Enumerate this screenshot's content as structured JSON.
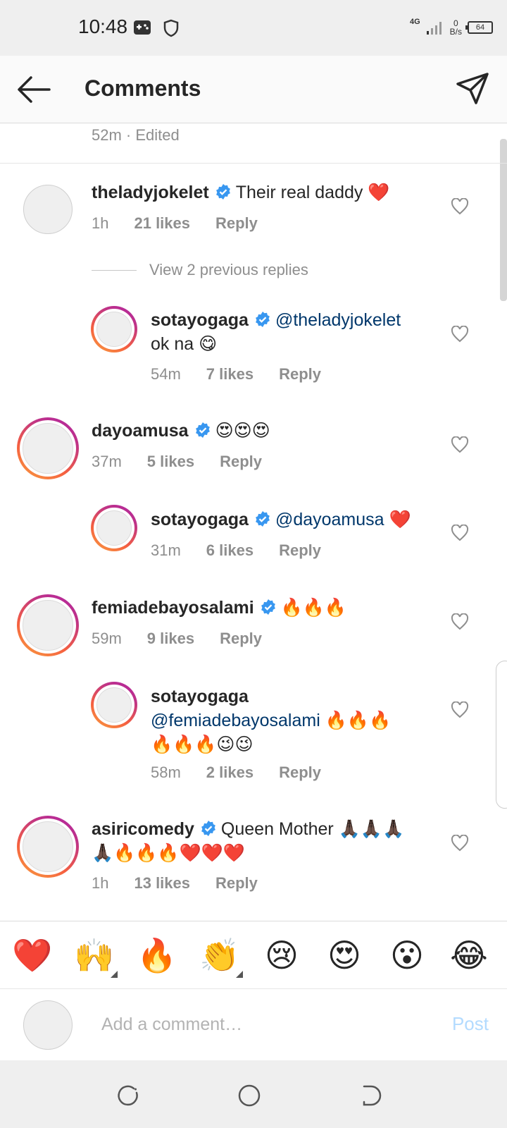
{
  "status_bar": {
    "time": "10:48",
    "network": "4G",
    "speed_value": "0",
    "speed_unit": "B/s",
    "battery": "64",
    "icons": [
      "game-icon",
      "shield-icon",
      "signal-icon",
      "battery-icon"
    ]
  },
  "header": {
    "title": "Comments",
    "back_icon": "arrow-left-icon",
    "share_icon": "send-icon"
  },
  "top_comment": {
    "meta": "52m · Edited"
  },
  "comments": [
    {
      "user": "theladyjokelet",
      "text": "Their real daddy ❤️",
      "time": "1h",
      "likes": "21 likes",
      "reply": "Reply",
      "verified": true
    },
    {
      "user": "sotayogaga",
      "mention": "@theladyjokelet",
      "text2": "ok na 😋",
      "time": "54m",
      "likes": "7 likes",
      "reply": "Reply",
      "verified": true
    },
    {
      "user": "dayoamusa",
      "text": "😍😍😍",
      "time": "37m",
      "likes": "5 likes",
      "reply": "Reply",
      "verified": true
    },
    {
      "user": "sotayogaga",
      "mention": "@dayoamusa",
      "text": "❤️",
      "time": "31m",
      "likes": "6 likes",
      "reply": "Reply",
      "verified": true
    },
    {
      "user": "femiadebayosalami",
      "text": "🔥🔥🔥",
      "time": "59m",
      "likes": "9 likes",
      "reply": "Reply",
      "verified": true
    },
    {
      "user": "sotayogaga",
      "mention": "@femiadebayosalami",
      "text": "🔥🔥🔥",
      "text2": "🔥🔥🔥😉😉",
      "time": "58m",
      "likes": "2 likes",
      "reply": "Reply",
      "verified": false
    },
    {
      "user": "asiricomedy",
      "text": "Queen Mother 🙏🏿🙏🏿🙏🏿",
      "text2": "🙏🏿🔥🔥🔥❤️❤️❤️",
      "time": "1h",
      "likes": "13 likes",
      "reply": "Reply",
      "verified": true
    }
  ],
  "view_replies": "View 2 previous replies",
  "emoji_bar": [
    "❤️",
    "🙌",
    "🔥",
    "👏",
    "😢",
    "😍",
    "😮",
    "😂"
  ],
  "composer": {
    "placeholder": "Add a comment…",
    "post": "Post"
  },
  "nav": {
    "icons": [
      "recents-icon",
      "home-icon",
      "back-icon"
    ]
  },
  "colors": {
    "mention": "#00376b",
    "muted": "#8e8e8e",
    "verified": "#3897f0",
    "post_disabled": "#b3dbff"
  }
}
